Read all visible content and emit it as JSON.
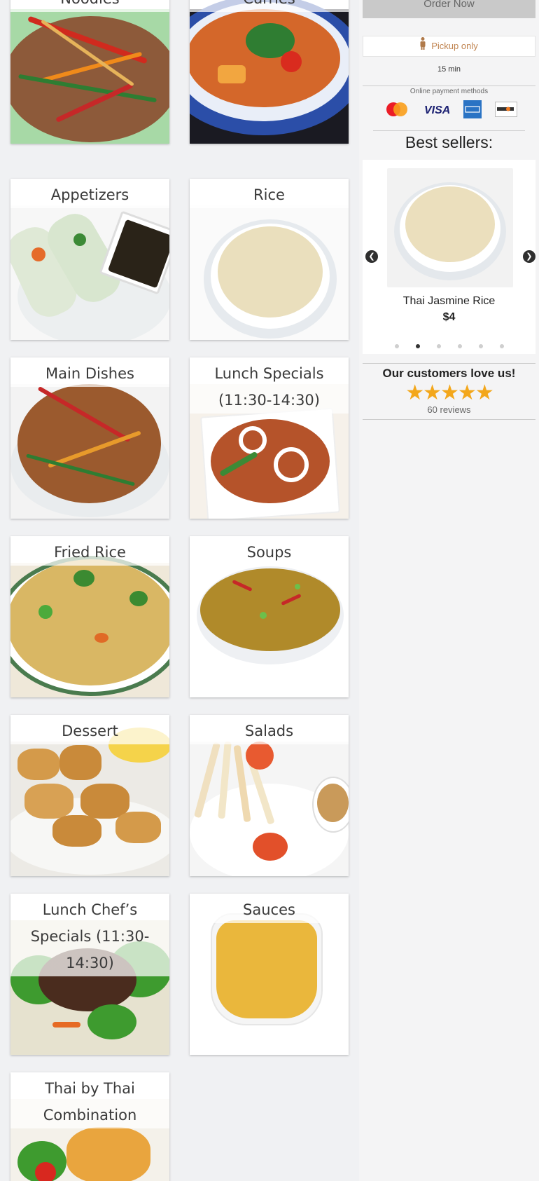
{
  "categories": [
    {
      "label": "Noodles"
    },
    {
      "label": "Curries"
    },
    {
      "label": "Appetizers"
    },
    {
      "label": "Rice"
    },
    {
      "label": "Main Dishes"
    },
    {
      "label": "Lunch Specials (11:30-14:30)"
    },
    {
      "label": "Fried Rice"
    },
    {
      "label": "Soups"
    },
    {
      "label": "Dessert"
    },
    {
      "label": "Salads"
    },
    {
      "label": "Lunch Chef’s Specials (11:30-14:30)"
    },
    {
      "label": "Sauces"
    },
    {
      "label": "Thai by Thai Combination"
    }
  ],
  "sidebar": {
    "order_button": "Order Now",
    "pickup_label": "Pickup only",
    "eta": "15 min",
    "payment_label": "Online payment methods",
    "payment_methods": [
      "mastercard-icon",
      "visa-icon",
      "amex-icon",
      "discover-icon"
    ],
    "best_sellers_title": "Best sellers:",
    "best_seller": {
      "name": "Thai Jasmine Rice",
      "price": "$4"
    },
    "carousel_pages": 6,
    "carousel_active": 2,
    "love_title": "Our customers love us!",
    "rating_stars": "★★★★★",
    "rating_value": 5,
    "reviews": "60 reviews"
  },
  "colors": {
    "accent": "#c08450",
    "stars": "#f3a71b",
    "background": "#f0f1f3"
  }
}
